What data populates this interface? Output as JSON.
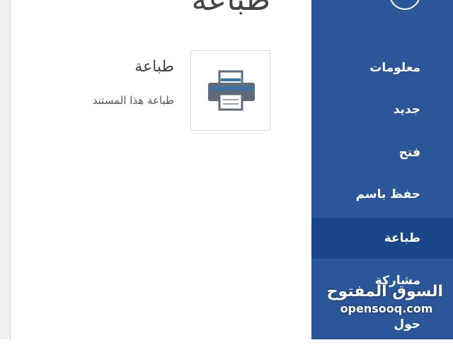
{
  "window": {
    "page_title": "طباعة"
  },
  "print_panel": {
    "heading": "طباعة",
    "description": "طباعة هذا المستند",
    "tile_icon": "printer-icon"
  },
  "sidebar": {
    "back_icon": "back-arrow-icon",
    "items": [
      {
        "label": "معلومات",
        "active": false
      },
      {
        "label": "جديد",
        "active": false
      },
      {
        "label": "فتح",
        "active": false
      },
      {
        "label": "حفظ باسم",
        "active": false
      },
      {
        "label": "طباعة",
        "active": true
      },
      {
        "label": "مشاركة",
        "active": false
      },
      {
        "label": "حول",
        "active": false
      }
    ]
  },
  "watermark": {
    "arabic": "السوق المفتوح",
    "latin": "opensooq.com"
  },
  "colors": {
    "sidebar_bg": "#2b579a",
    "sidebar_active": "#19478a",
    "printer_body": "#5f6b7a",
    "printer_accent": "#2e75b6"
  }
}
